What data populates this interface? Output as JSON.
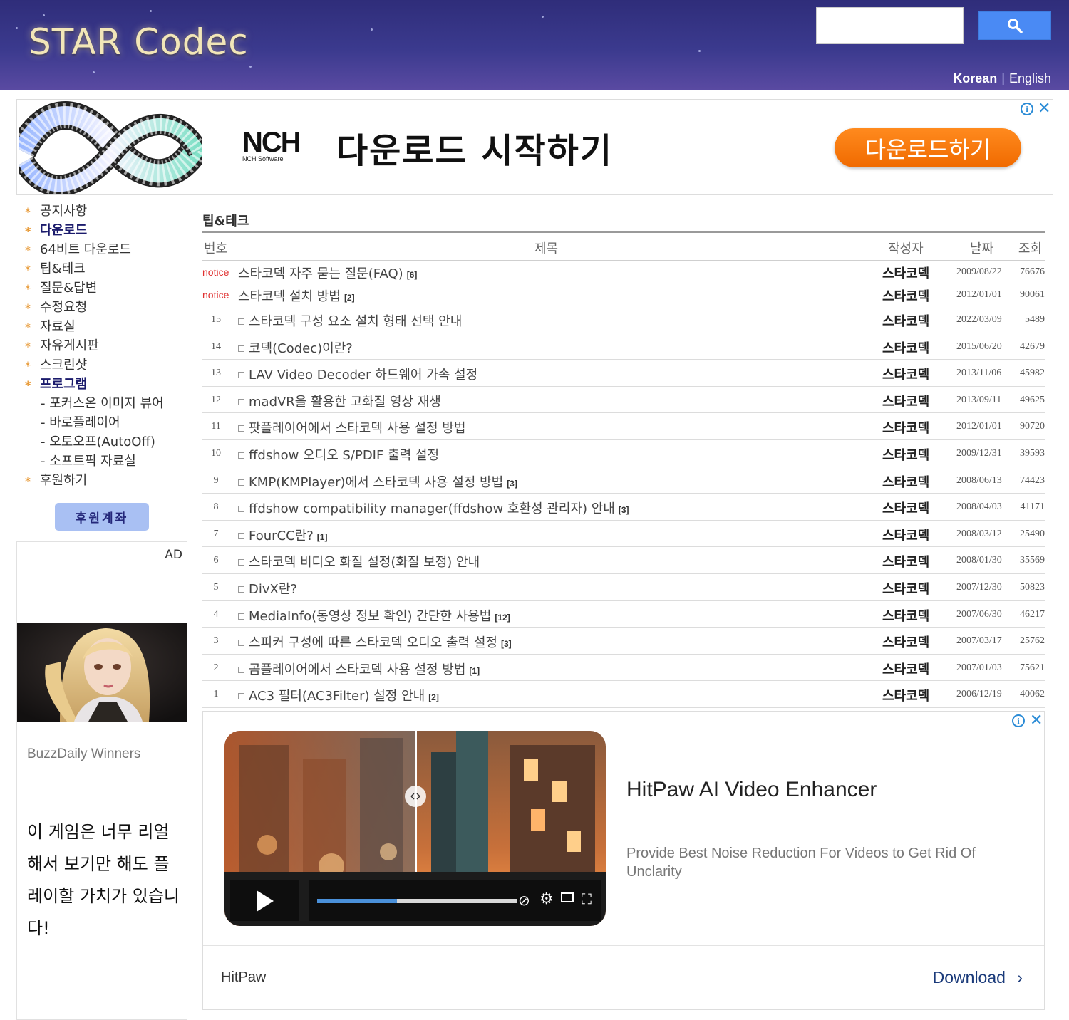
{
  "header": {
    "logo": "STAR Codec",
    "search": {
      "placeholder": "",
      "button_icon": "search-icon"
    },
    "languages": [
      {
        "label": "Korean",
        "active": true
      },
      {
        "label": "English",
        "active": false
      }
    ],
    "lang_separator": "|"
  },
  "top_ad": {
    "brand_logo": "NCH",
    "brand_sub": "NCH Software",
    "headline": "다운로드 시작하기",
    "cta": "다운로드하기",
    "info_icon": "info-icon",
    "close_icon": "close-icon"
  },
  "sidebar": {
    "menu": [
      {
        "label": "공지사항",
        "bold": false
      },
      {
        "label": "다운로드",
        "bold": true
      },
      {
        "label": "64비트 다운로드",
        "bold": false
      },
      {
        "label": "팁&테크",
        "bold": false
      },
      {
        "label": "질문&답변",
        "bold": false
      },
      {
        "label": "수정요청",
        "bold": false
      },
      {
        "label": "자료실",
        "bold": false
      },
      {
        "label": "자유게시판",
        "bold": false
      },
      {
        "label": "스크린샷",
        "bold": false
      },
      {
        "label": "프로그램",
        "bold": true
      }
    ],
    "submenu": [
      "- 포커스온 이미지 뷰어",
      "- 바로플레이어",
      "- 오토오프(AutoOff)",
      "- 소프트픽 자료실"
    ],
    "donate_menu": "후원하기",
    "bullet": "*",
    "donate_button": "후원계좌",
    "ad": {
      "label": "AD",
      "brand": "BuzzDaily Winners",
      "copy": "이 게임은 너무 리얼해서 보기만 해도 플레이할 가치가 있습니다!"
    }
  },
  "board": {
    "title": "팁&테크",
    "columns": {
      "no": "번호",
      "title": "제목",
      "author": "작성자",
      "date": "날짜",
      "views": "조회"
    },
    "notices": [
      {
        "no": "notice",
        "title": "스타코덱 자주 묻는 질문(FAQ)",
        "comments": "[6]",
        "author": "스타코덱",
        "date": "2009/08/22",
        "views": "76676"
      },
      {
        "no": "notice",
        "title": "스타코덱 설치 방법",
        "comments": "[2]",
        "author": "스타코덱",
        "date": "2012/01/01",
        "views": "90061"
      }
    ],
    "posts": [
      {
        "no": "15",
        "title": "스타코덱 구성 요소 설치 형태 선택 안내",
        "comments": "",
        "author": "스타코덱",
        "date": "2022/03/09",
        "views": "5489"
      },
      {
        "no": "14",
        "title": "코덱(Codec)이란?",
        "comments": "",
        "author": "스타코덱",
        "date": "2015/06/20",
        "views": "42679"
      },
      {
        "no": "13",
        "title": "LAV Video Decoder 하드웨어 가속 설정",
        "comments": "",
        "author": "스타코덱",
        "date": "2013/11/06",
        "views": "45982"
      },
      {
        "no": "12",
        "title": "madVR을 활용한 고화질 영상 재생",
        "comments": "",
        "author": "스타코덱",
        "date": "2013/09/11",
        "views": "49625"
      },
      {
        "no": "11",
        "title": "팟플레이어에서 스타코덱 사용 설정 방법",
        "comments": "",
        "author": "스타코덱",
        "date": "2012/01/01",
        "views": "90720"
      },
      {
        "no": "10",
        "title": "ffdshow 오디오 S/PDIF 출력 설정",
        "comments": "",
        "author": "스타코덱",
        "date": "2009/12/31",
        "views": "39593"
      },
      {
        "no": "9",
        "title": "KMP(KMPlayer)에서 스타코덱 사용 설정 방법",
        "comments": "[3]",
        "author": "스타코덱",
        "date": "2008/06/13",
        "views": "74423"
      },
      {
        "no": "8",
        "title": "ffdshow compatibility manager(ffdshow 호환성 관리자) 안내",
        "comments": "[3]",
        "author": "스타코덱",
        "date": "2008/04/03",
        "views": "41171"
      },
      {
        "no": "7",
        "title": "FourCC란?",
        "comments": "[1]",
        "author": "스타코덱",
        "date": "2008/03/12",
        "views": "25490"
      },
      {
        "no": "6",
        "title": "스타코덱 비디오 화질 설정(화질 보정) 안내",
        "comments": "",
        "author": "스타코덱",
        "date": "2008/01/30",
        "views": "35569"
      },
      {
        "no": "5",
        "title": "DivX란?",
        "comments": "",
        "author": "스타코덱",
        "date": "2007/12/30",
        "views": "50823"
      },
      {
        "no": "4",
        "title": "MediaInfo(동영상 정보 확인) 간단한 사용법",
        "comments": "[12]",
        "author": "스타코덱",
        "date": "2007/06/30",
        "views": "46217"
      },
      {
        "no": "3",
        "title": "스피커 구성에 따른 스타코덱 오디오 출력 설정",
        "comments": "[3]",
        "author": "스타코덱",
        "date": "2007/03/17",
        "views": "25762"
      },
      {
        "no": "2",
        "title": "곰플레이어에서 스타코덱 사용 설정 방법",
        "comments": "[1]",
        "author": "스타코덱",
        "date": "2007/01/03",
        "views": "75621"
      },
      {
        "no": "1",
        "title": "AC3 필터(AC3Filter) 설정 안내",
        "comments": "[2]",
        "author": "스타코덱",
        "date": "2006/12/19",
        "views": "40062"
      }
    ]
  },
  "bottom_ad": {
    "title": "HitPaw AI Video Enhancer",
    "description": "Provide Best Noise Reduction For Videos to Get Rid Of Unclarity",
    "brand": "HitPaw",
    "cta": "Download",
    "video_progress": 0.4,
    "icons": [
      "play-icon",
      "mute-icon",
      "settings-icon",
      "pip-icon",
      "fullscreen-icon",
      "compare-handle-icon"
    ]
  },
  "colors": {
    "header_bg": "#3b3a8e",
    "search_button": "#4a8af4",
    "accent_bullet": "#e7962f",
    "notice_red": "#e03030",
    "ad_orange": "#f57a0a",
    "donate_button": "#a9c0f3",
    "download_link": "#1a3a7a"
  }
}
